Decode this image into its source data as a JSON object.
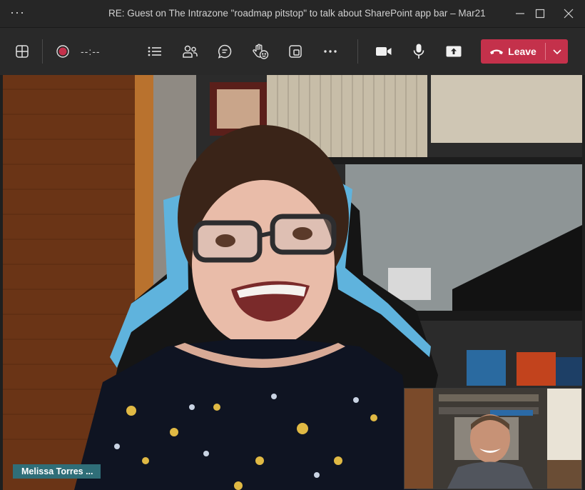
{
  "window": {
    "title": "RE: Guest on The Intrazone \"roadmap pitstop\" to talk about SharePoint app bar – Mar21",
    "menu_icon": "more-horizontal-icon",
    "controls": [
      "minimize-icon",
      "maximize-icon",
      "close-icon"
    ]
  },
  "toolbar": {
    "record_timer": "--:--",
    "icons": [
      "grid-view-icon",
      "record-icon",
      "participant-list-icon",
      "people-icon",
      "chat-icon",
      "raise-hand-icon",
      "pop-out-icon",
      "more-actions-icon",
      "camera-icon",
      "microphone-icon",
      "share-screen-icon"
    ],
    "leave_label": "Leave",
    "leave_color": "#c4314b"
  },
  "video": {
    "main_participant_name": "Melissa Torres ...",
    "name_badge_color": "#2f6e78"
  }
}
